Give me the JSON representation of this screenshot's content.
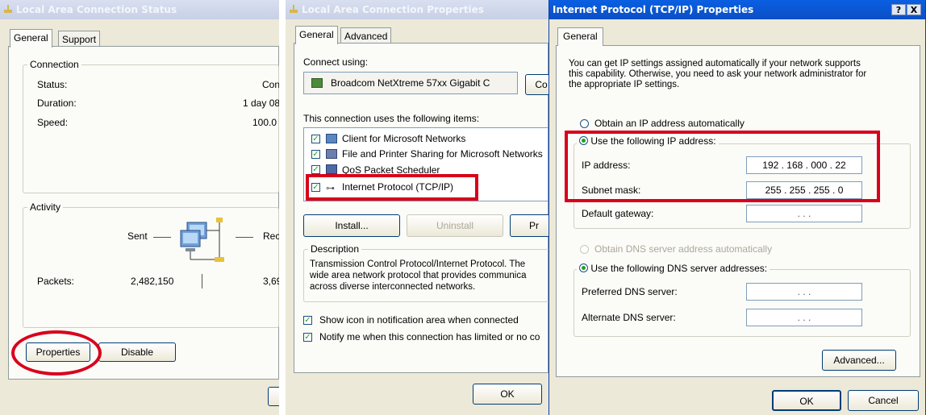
{
  "windows": {
    "status": {
      "title": "Local Area Connection Status",
      "tabs": [
        "General",
        "Support"
      ],
      "connection": {
        "legend": "Connection",
        "status_label": "Status:",
        "status_value": "Conn",
        "duration_label": "Duration:",
        "duration_value": "1 day 08:",
        "speed_label": "Speed:",
        "speed_value": "100.0"
      },
      "activity": {
        "legend": "Activity",
        "sent_label": "Sent",
        "received_label": "Rec",
        "packets_label": "Packets:",
        "packets_sent": "2,482,150",
        "packets_received": "3,69"
      },
      "buttons": {
        "properties": "Properties",
        "disable": "Disable"
      }
    },
    "lan_properties": {
      "title": "Local Area Connection Properties",
      "tabs": [
        "General",
        "Advanced"
      ],
      "connect_using_label": "Connect using:",
      "adapter_name": "Broadcom NetXtreme 57xx Gigabit C",
      "configure_button": "Co",
      "items_label": "This connection uses the following items:",
      "items": [
        {
          "label": "Client for Microsoft Networks",
          "checked": true,
          "icon": "network-client-icon"
        },
        {
          "label": "File and Printer Sharing for Microsoft Networks",
          "checked": true,
          "icon": "file-printer-sharing-icon"
        },
        {
          "label": "QoS Packet Scheduler",
          "checked": true,
          "icon": "qos-scheduler-icon"
        },
        {
          "label": "Internet Protocol (TCP/IP)",
          "checked": true,
          "icon": "protocol-icon"
        }
      ],
      "buttons": {
        "install": "Install...",
        "uninstall": "Uninstall",
        "properties": "Pr",
        "ok": "OK"
      },
      "description_legend": "Description",
      "description_lines": [
        "Transmission Control Protocol/Internet Protocol. The",
        "wide area network protocol that provides communica",
        "across diverse interconnected networks."
      ],
      "show_icon_label": "Show icon in notification area when connected",
      "notify_label": "Notify me when this connection has limited or no co"
    },
    "tcpip": {
      "title": "Internet Protocol (TCP/IP) Properties",
      "title_buttons": {
        "help": "?",
        "close": "X"
      },
      "tabs": [
        "General"
      ],
      "intro_lines": [
        "You can get IP settings assigned automatically if your network supports",
        "this capability. Otherwise, you need to ask your network administrator for",
        "the appropriate IP settings."
      ],
      "obtain_ip_label": "Obtain an IP address automatically",
      "use_ip_label": "Use the following IP address:",
      "ip_address_label": "IP address:",
      "ip_address_value": "192 . 168 . 000 . 22",
      "subnet_label": "Subnet mask:",
      "subnet_value": "255 . 255 . 255 .  0",
      "gateway_label": "Default gateway:",
      "gateway_value": ".        .        .",
      "obtain_dns_label": "Obtain DNS server address automatically",
      "use_dns_label": "Use the following DNS server addresses:",
      "preferred_dns_label": "Preferred DNS server:",
      "preferred_dns_value": ".        .        .",
      "alternate_dns_label": "Alternate DNS server:",
      "alternate_dns_value": ".        .        .",
      "buttons": {
        "advanced": "Advanced...",
        "ok": "OK",
        "cancel": "Cancel"
      }
    }
  },
  "colors": {
    "highlight": "#d9001b",
    "window_bg": "#ece9d8",
    "titlebar_active": "#0b55d8"
  }
}
